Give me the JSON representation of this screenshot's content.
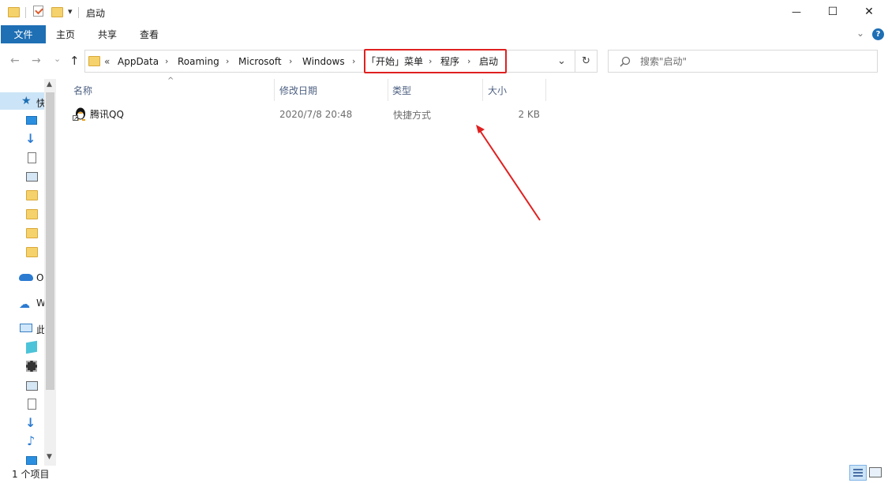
{
  "titlebar": {
    "title": "启动",
    "qa_arrow": "▾"
  },
  "window_controls": {
    "minimize": "—",
    "maximize": "☐",
    "close": "✕"
  },
  "ribbon": {
    "file": "文件",
    "home": "主页",
    "share": "共享",
    "view": "查看",
    "help_icon": "?"
  },
  "nav_buttons": {
    "back": "←",
    "forward": "→",
    "recent": "⌄",
    "up": "↑"
  },
  "address": {
    "overflow": "«",
    "crumbs": [
      "AppData",
      "Roaming",
      "Microsoft",
      "Windows",
      "「开始」菜单",
      "程序",
      "启动"
    ],
    "separator": "›",
    "dropdown": "⌄",
    "refresh": "↻"
  },
  "search": {
    "placeholder": "搜索\"启动\""
  },
  "nav_pane": {
    "items": [
      {
        "icon": "star-icon",
        "label": "快"
      },
      {
        "icon": "desktop-icon",
        "label": ""
      },
      {
        "icon": "download-icon",
        "label": ""
      },
      {
        "icon": "document-icon",
        "label": ""
      },
      {
        "icon": "picture-icon",
        "label": ""
      },
      {
        "icon": "folder-icon",
        "label": ""
      },
      {
        "icon": "folder-icon",
        "label": ""
      },
      {
        "icon": "folder-icon",
        "label": ""
      },
      {
        "icon": "folder-icon",
        "label": ""
      },
      {
        "icon": "onedrive-icon",
        "label": "O"
      },
      {
        "icon": "wps-cloud-icon",
        "label": "W"
      },
      {
        "icon": "this-pc-icon",
        "label": "此"
      },
      {
        "icon": "3d-objects-icon",
        "label": ""
      },
      {
        "icon": "video-icon",
        "label": ""
      },
      {
        "icon": "picture-icon",
        "label": ""
      },
      {
        "icon": "document-icon",
        "label": ""
      },
      {
        "icon": "download-icon",
        "label": ""
      },
      {
        "icon": "music-icon",
        "label": ""
      },
      {
        "icon": "desktop-icon",
        "label": ""
      }
    ]
  },
  "columns": {
    "name": "名称",
    "modified": "修改日期",
    "type": "类型",
    "size": "大小",
    "sort_indicator": "^"
  },
  "files": [
    {
      "name": "腾讯QQ",
      "modified": "2020/7/8 20:48",
      "type": "快捷方式",
      "size": "2 KB"
    }
  ],
  "status": {
    "count": "1 个项目"
  },
  "colors": {
    "accent": "#1e6fb4",
    "highlight_box": "#e02020",
    "arrow": "#e02020"
  }
}
